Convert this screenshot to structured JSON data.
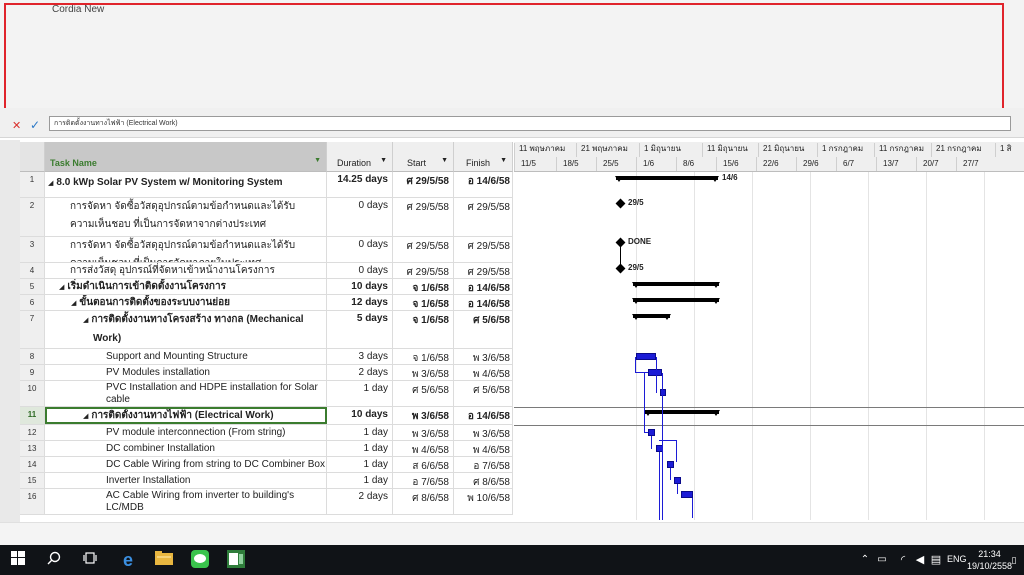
{
  "ribbon": {
    "font_name": "Cordia New"
  },
  "entry_bar": {
    "value": "การติดตั้งงานทางไฟฟ้า (Electrical Work)"
  },
  "columns": {
    "task_name": "Task Name",
    "duration": "Duration",
    "start": "Start",
    "finish": "Finish"
  },
  "rows": [
    {
      "num": "1",
      "name": "8.0 kWp Solar PV System w/ Monitoring System",
      "duration": "14.25 days",
      "start": "ศ 29/5/58",
      "finish": "อ 14/6/58"
    },
    {
      "num": "2",
      "name": "การจัดหา จัดซื้อวัสดุอุปกรณ์ตามข้อกำหนดและได้รับความเห็นชอบ ที่เป็นการจัดหาจากต่างประเทศ",
      "duration": "0 days",
      "start": "ศ 29/5/58",
      "finish": "ศ 29/5/58"
    },
    {
      "num": "3",
      "name": "การจัดหา จัดซื้อวัสดุอุปกรณ์ตามข้อกำหนดและได้รับความเห็นชอบ ที่เป็นการจัดหาภายในประเทศ",
      "duration": "0 days",
      "start": "ศ 29/5/58",
      "finish": "ศ 29/5/58"
    },
    {
      "num": "4",
      "name": "การส่งวัสดุ อุปกรณ์ที่จัดหาเข้าหน้างานโครงการ",
      "duration": "0 days",
      "start": "ศ 29/5/58",
      "finish": "ศ 29/5/58"
    },
    {
      "num": "5",
      "name": "เริ่มดำเนินการเข้าติดตั้งงานโครงการ",
      "duration": "10 days",
      "start": "จ 1/6/58",
      "finish": "อ 14/6/58"
    },
    {
      "num": "6",
      "name": "ขั้นตอนการติดตั้งของระบบงานย่อย",
      "duration": "12 days",
      "start": "จ 1/6/58",
      "finish": "อ 14/6/58"
    },
    {
      "num": "7",
      "name": "การติดตั้งงานทางโครงสร้าง ทางกล (Mechanical Work)",
      "duration": "5 days",
      "start": "จ 1/6/58",
      "finish": "ศ 5/6/58"
    },
    {
      "num": "8",
      "name": "Support and Mounting Structure",
      "duration": "3 days",
      "start": "จ 1/6/58",
      "finish": "พ 3/6/58"
    },
    {
      "num": "9",
      "name": "PV Modules installation",
      "duration": "2 days",
      "start": "พ 3/6/58",
      "finish": "พ 4/6/58"
    },
    {
      "num": "10",
      "name": "PVC Installation and HDPE installation for Solar cable",
      "duration": "1 day",
      "start": "ศ 5/6/58",
      "finish": "ศ 5/6/58"
    },
    {
      "num": "11",
      "name": "การติดตั้งงานทางไฟฟ้า (Electrical Work)",
      "duration": "10 days",
      "start": "พ 3/6/58",
      "finish": "อ 14/6/58"
    },
    {
      "num": "12",
      "name": "PV module interconnection (From string)",
      "duration": "1 day",
      "start": "พ 3/6/58",
      "finish": "พ 3/6/58"
    },
    {
      "num": "13",
      "name": "DC combiner Installation",
      "duration": "1 day",
      "start": "พ 4/6/58",
      "finish": "พ 4/6/58"
    },
    {
      "num": "14",
      "name": "DC Cable Wiring from string to DC Combiner Box",
      "duration": "1 day",
      "start": "ส 6/6/58",
      "finish": "อ 7/6/58"
    },
    {
      "num": "15",
      "name": "Inverter Installation",
      "duration": "1 day",
      "start": "อ 7/6/58",
      "finish": "ศ 8/6/58"
    },
    {
      "num": "16",
      "name": "AC Cable Wiring from inverter to building's LC/MDB",
      "duration": "2 days",
      "start": "ศ 8/6/58",
      "finish": "พ 10/6/58"
    }
  ],
  "timescale": {
    "top": [
      "11 พฤษภาคม",
      "21 พฤษภาคม",
      "1 มิถุนายน",
      "11 มิถุนายน",
      "21 มิถุนายน",
      "1 กรกฎาคม",
      "11 กรกฎาคม",
      "21 กรกฎาคม",
      "1 สิ"
    ],
    "bottom": [
      "11/5",
      "18/5",
      "25/5",
      "1/6",
      "8/6",
      "15/6",
      "22/6",
      "29/6",
      "6/7",
      "13/7",
      "20/7",
      "27/7"
    ]
  },
  "gantt_labels": {
    "row1": "14/6",
    "row2": "29/5",
    "row3": "DONE",
    "row4": "29/5"
  },
  "taskbar": {
    "lang": "ENG",
    "time": "21:34",
    "date": "19/10/2558"
  },
  "colors": {
    "accent_green": "#3b7c2f",
    "task_bar": "#1c1cd6",
    "highlight_red": "#e0242b"
  }
}
